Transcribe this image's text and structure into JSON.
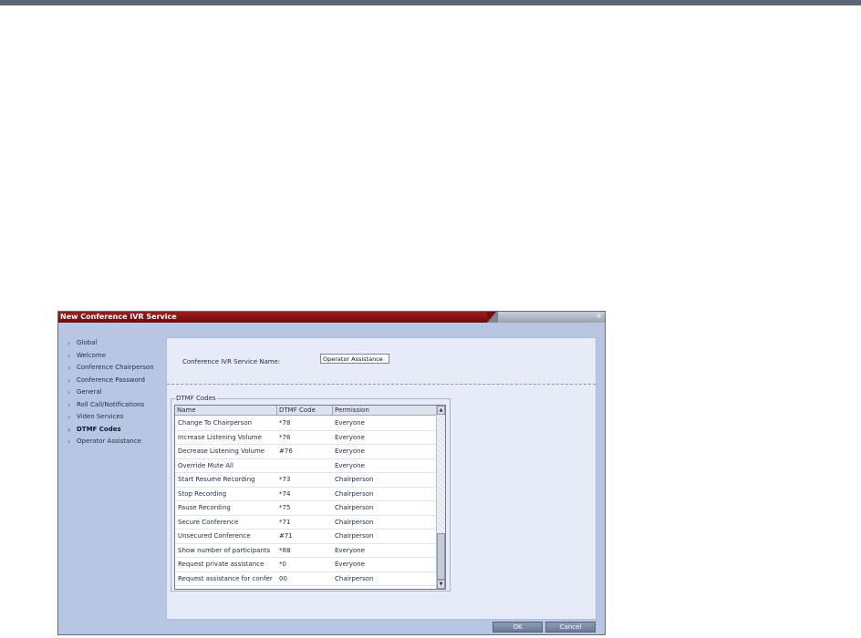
{
  "dialog": {
    "title": "New Conference IVR Service",
    "close_glyph": "×"
  },
  "nav": {
    "items": [
      {
        "label": "Global"
      },
      {
        "label": "Welcome"
      },
      {
        "label": "Conference Chairperson"
      },
      {
        "label": "Conference Password"
      },
      {
        "label": "General"
      },
      {
        "label": "Roll Call/Notifications"
      },
      {
        "label": "Video Services"
      },
      {
        "label": "DTMF Codes",
        "active": true
      },
      {
        "label": "Operator Assistance"
      }
    ]
  },
  "form": {
    "service_name_label": "Conference IVR Service Name:",
    "service_name_value": "Operator Assistance"
  },
  "dtmf": {
    "legend": "DTMF Codes",
    "columns": [
      "Name",
      "DTMF Code",
      "Permission"
    ],
    "rows": [
      {
        "name": "Change To Chairperson",
        "code": "*78",
        "permission": "Everyone"
      },
      {
        "name": "Increase Listening Volume",
        "code": "*76",
        "permission": "Everyone"
      },
      {
        "name": "Decrease Listening Volume",
        "code": "#76",
        "permission": "Everyone"
      },
      {
        "name": "Override Mute All",
        "code": "",
        "permission": "Everyone"
      },
      {
        "name": "Start Resume Recording",
        "code": "*73",
        "permission": "Chairperson"
      },
      {
        "name": "Stop Recording",
        "code": "*74",
        "permission": "Chairperson"
      },
      {
        "name": "Pause Recording",
        "code": "*75",
        "permission": "Chairperson"
      },
      {
        "name": "Secure Conference",
        "code": "*71",
        "permission": "Chairperson"
      },
      {
        "name": "Unsecured Conference",
        "code": "#71",
        "permission": "Chairperson"
      },
      {
        "name": "Show number of participants",
        "code": "*88",
        "permission": "Everyone"
      },
      {
        "name": "Request private assistance",
        "code": "*0",
        "permission": "Everyone"
      },
      {
        "name": "Request assistance for confer",
        "code": "00",
        "permission": "Chairperson"
      }
    ]
  },
  "buttons": {
    "ok": "OK",
    "cancel": "Cancel"
  },
  "icons": {
    "nav_arrow": "chevron-right-icon",
    "scroll_up": "arrow-up-icon",
    "scroll_down": "arrow-down-icon"
  },
  "colors": {
    "title_red": "#a61a1a",
    "dialog_bg": "#b9c6e3",
    "content_bg": "#e6ebf7",
    "nav_arrow": "#2b65c4"
  }
}
